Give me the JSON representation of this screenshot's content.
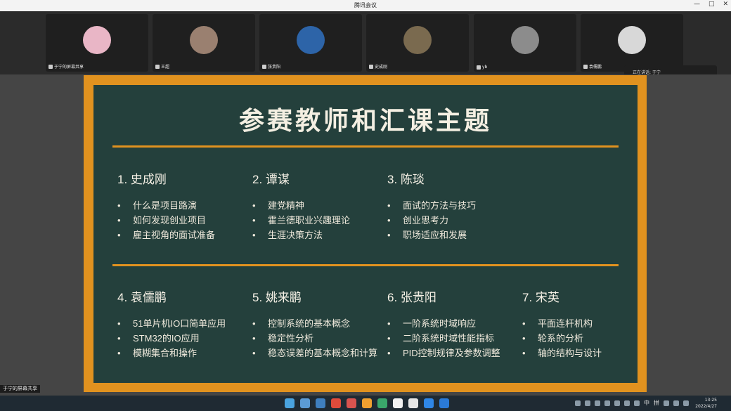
{
  "window": {
    "title": "腾讯会议"
  },
  "participants": [
    {
      "name": "于宁的屏幕共享",
      "avatar_color": "#e9b6c6"
    },
    {
      "name": "王超",
      "avatar_color": "#9a8070"
    },
    {
      "name": "张贵阳",
      "avatar_color": "#2d64a8"
    },
    {
      "name": "史成刚",
      "avatar_color": "#7a6a4f"
    },
    {
      "name": "yb",
      "avatar_color": "#8c8c8c"
    },
    {
      "name": "袁儒鹏",
      "avatar_color": "#d8d8d8"
    }
  ],
  "speaking": {
    "label": "正在讲话: 于宁"
  },
  "slide": {
    "title": "参赛教师和汇课主题",
    "accent_color": "#e1921f",
    "board_color": "#24403c",
    "teachers": [
      {
        "name": "1. 史成刚",
        "topics": [
          "什么是项目路演",
          "如何发现创业项目",
          "雇主视角的面试准备"
        ]
      },
      {
        "name": "2. 谭谋",
        "topics": [
          "建党精神",
          "霍兰德职业兴趣理论",
          "生涯决策方法"
        ]
      },
      {
        "name": "3. 陈琰",
        "topics": [
          "面试的方法与技巧",
          "创业思考力",
          "职场适应和发展"
        ]
      },
      {
        "name": "4. 袁儒鹏",
        "topics": [
          "51单片机IO口简单应用",
          "STM32的IO应用",
          "模糊集合和操作"
        ]
      },
      {
        "name": "5. 姚来鹏",
        "topics": [
          "控制系统的基本概念",
          "稳定性分析",
          "稳态误差的基本概念和计算"
        ]
      },
      {
        "name": "6. 张贵阳",
        "topics": [
          "一阶系统时域响应",
          "二阶系统时域性能指标",
          "PID控制规律及参数调整"
        ]
      },
      {
        "name": "7. 宋英",
        "topics": [
          "平面连杆机构",
          "轮系的分析",
          "轴的结构与设计"
        ]
      }
    ]
  },
  "screen_share_label": "于宁的屏幕共享",
  "taskbar": {
    "icons": [
      {
        "name": "windows-start-icon",
        "color": "#4aa3df"
      },
      {
        "name": "search-icon",
        "color": "#5b9bd5"
      },
      {
        "name": "task-view-icon",
        "color": "#3f7fbf"
      },
      {
        "name": "chrome-icon",
        "color": "#e04b3b"
      },
      {
        "name": "wps-icon",
        "color": "#d9534f"
      },
      {
        "name": "dev-tool-icon",
        "color": "#f0a030"
      },
      {
        "name": "sheets-icon",
        "color": "#3aa66b"
      },
      {
        "name": "typora-icon",
        "color": "#f2f2f2"
      },
      {
        "name": "notes-icon",
        "color": "#e6e6e6"
      },
      {
        "name": "tencent-meeting-icon",
        "color": "#2f86e6"
      },
      {
        "name": "tencent-meeting-active-icon",
        "color": "#2a7ad8"
      }
    ],
    "ime": "中",
    "ime2": "拼",
    "time": "13:25",
    "date": "2022/4/27"
  }
}
